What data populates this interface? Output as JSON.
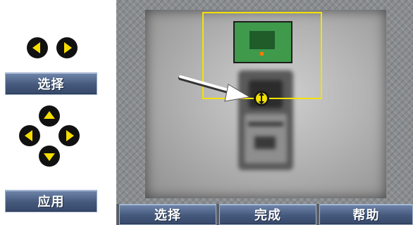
{
  "side_panel": {
    "select_label": "选择",
    "apply_label": "应用"
  },
  "bottom_bar": {
    "select_label": "选择",
    "done_label": "完成",
    "help_label": "帮助"
  },
  "colors": {
    "button_fill": "#45597c",
    "arrow_yellow": "#f6dd00",
    "roi_box": "#f2e300",
    "zoom_green": "#3f9a4c",
    "marker_orange": "#ff7a00"
  },
  "icons": [
    "left-arrow-icon",
    "right-arrow-icon",
    "up-arrow-icon",
    "down-arrow-icon",
    "move-handle-icon",
    "pointer-arrow-icon"
  ]
}
